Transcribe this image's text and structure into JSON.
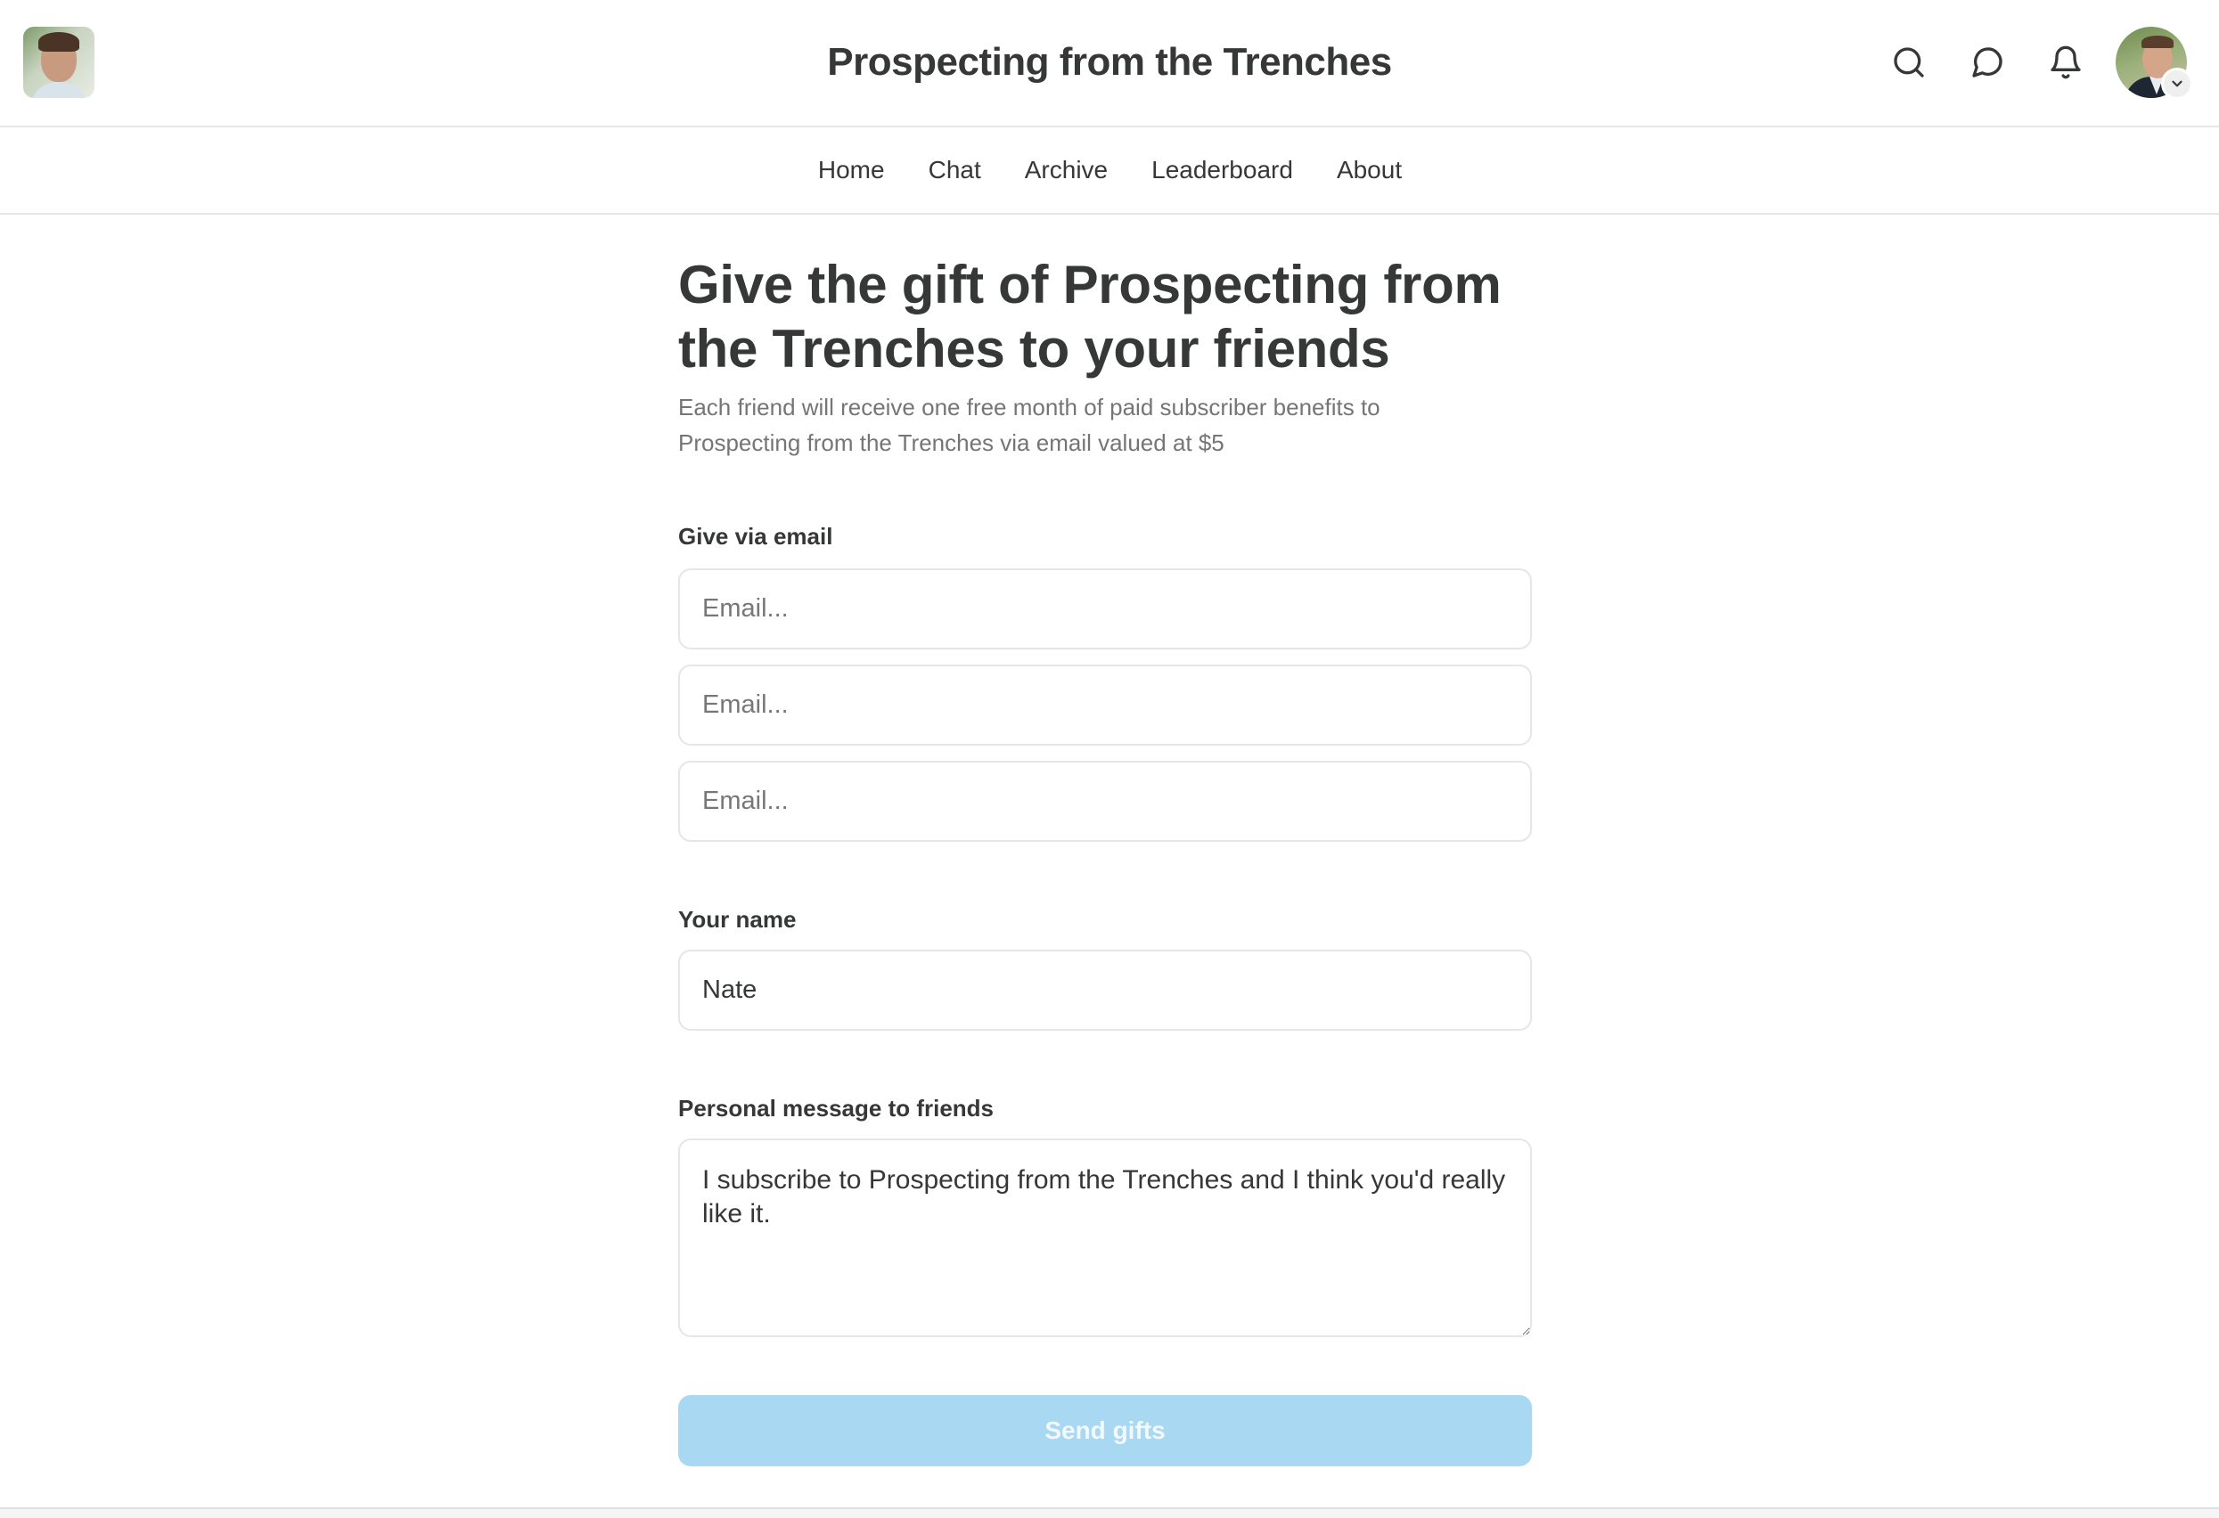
{
  "header": {
    "title": "Prospecting from the Trenches",
    "logo_alt": "Publication logo",
    "icons": {
      "search": "search-icon",
      "chat": "chat-bubble-icon",
      "notifications": "bell-icon",
      "avatar_menu": "chevron-down-icon"
    }
  },
  "nav": {
    "items": [
      {
        "label": "Home"
      },
      {
        "label": "Chat"
      },
      {
        "label": "Archive"
      },
      {
        "label": "Leaderboard"
      },
      {
        "label": "About"
      }
    ]
  },
  "gift_form": {
    "heading": "Give the gift of Prospecting from the Trenches to your friends",
    "subtitle": "Each friend will receive one free month of paid subscriber benefits to Prospecting from the Trenches via email valued at $5",
    "email_section": {
      "label": "Give via email",
      "fields": [
        {
          "placeholder": "Email...",
          "value": ""
        },
        {
          "placeholder": "Email...",
          "value": ""
        },
        {
          "placeholder": "Email...",
          "value": ""
        }
      ]
    },
    "name_section": {
      "label": "Your name",
      "value": "Nate"
    },
    "message_section": {
      "label": "Personal message to friends",
      "value": "I subscribe to Prospecting from the Trenches and I think you'd really like it."
    },
    "submit": {
      "label": "Send gifts",
      "disabled": true
    }
  },
  "colors": {
    "text_primary": "#363737",
    "text_secondary": "#757575",
    "border": "#e6e6e6",
    "button_disabled_bg": "#a9d8f2",
    "button_text": "#f2f9fd"
  }
}
